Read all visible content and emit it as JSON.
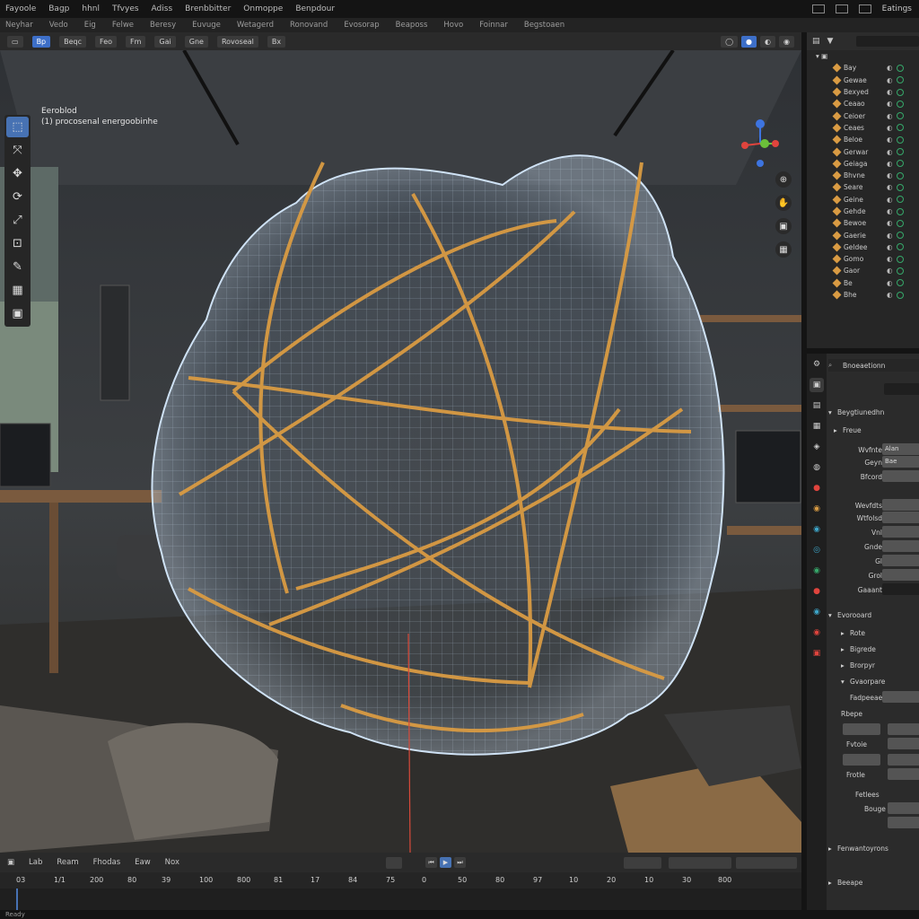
{
  "menubar": {
    "items": [
      "Fayoole",
      "Bagp",
      "hhnl",
      "Tfvyes",
      "Adiss",
      "Brenbbitter",
      "Onmoppe",
      "Benpdour"
    ],
    "right": [
      "Eatings"
    ]
  },
  "tabs": [
    "Neyhar",
    "Vedo",
    "Eig",
    "Felwe",
    "Beresy",
    "Euvuge",
    "Wetagerd",
    "Ronovand",
    "Evosorap",
    "Beaposs",
    "Hovo",
    "Foinnar",
    "Begstoaen"
  ],
  "viewport_header": {
    "mode": "Bp",
    "buttons": [
      "Beqc",
      "Feo",
      "Fm",
      "Gai",
      "Gne",
      "Rovoseal",
      "Bx"
    ]
  },
  "viewport": {
    "overlay_line1": "Eeroblod",
    "overlay_line2": "(1) procosenal energoobinhe"
  },
  "toolbar": {
    "tools": [
      {
        "name": "select-tool",
        "glyph": "⬚"
      },
      {
        "name": "cursor-tool",
        "glyph": "⤧"
      },
      {
        "name": "move-tool",
        "glyph": "✥"
      },
      {
        "name": "rotate-tool",
        "glyph": "⟳"
      },
      {
        "name": "scale-tool",
        "glyph": "⤢"
      },
      {
        "name": "transform-tool",
        "glyph": "⊡"
      },
      {
        "name": "annotate-tool",
        "glyph": "✎"
      },
      {
        "name": "measure-tool",
        "glyph": "▦"
      },
      {
        "name": "add-tool",
        "glyph": "▣"
      },
      {
        "name": "extra-tool",
        "glyph": "▤"
      }
    ]
  },
  "outliner": {
    "rows": [
      "Bay",
      "Gewae",
      "Bexyed",
      "Ceaao",
      "Ceioer",
      "Ceaes",
      "Beloe",
      "Gerwar",
      "Geiaga",
      "Bhvne",
      "Seare",
      "Geine",
      "Gehde",
      "Bewoe",
      "Gaerie",
      "Geldee",
      "Gomo",
      "Gaor",
      "Be",
      "Bhe"
    ]
  },
  "properties": {
    "title": "Bnoeaetionn",
    "section1": "Beygtiunedhn",
    "rows": [
      {
        "label": "Freue",
        "value": ""
      },
      {
        "label": "Wvfnte",
        "value": "Alan"
      },
      {
        "label": "Geyn",
        "value": "Bae"
      },
      {
        "label": "Bfcord",
        "value": ""
      },
      {
        "label": "Wevfdts",
        "value": ""
      },
      {
        "label": "Wtfolsd",
        "value": ""
      },
      {
        "label": "Vnl",
        "value": ""
      },
      {
        "label": "Gnde",
        "value": ""
      },
      {
        "label": "Gl",
        "value": ""
      },
      {
        "label": "Grol",
        "value": ""
      },
      {
        "label": "Gaaant",
        "value": ""
      }
    ],
    "section2": "Evorooard",
    "rows2": [
      "Rote",
      "Bigrede",
      "Brorpyr",
      "Gvaorpare"
    ],
    "section3": "Fadpeeaer",
    "rows3": [
      "Rbepe",
      "Fvtoie",
      "Frotle",
      "Fetlees",
      "Bouge"
    ],
    "section4": "Fenwantoyrons",
    "rows4": [
      "Beeape"
    ]
  },
  "timeline": {
    "labels": [
      "Lab",
      "Ream",
      "Fhodas",
      "Eaw",
      "Nox"
    ],
    "ticks": [
      "03",
      "1/1",
      "200",
      "80",
      "39",
      "100",
      "800",
      "81",
      "17",
      "84",
      "75",
      "0",
      "50",
      "80",
      "97",
      "10",
      "20",
      "10",
      "30",
      "800"
    ]
  },
  "status": {
    "text": "Ready"
  },
  "colors": {
    "accent": "#4772b3",
    "wire": "#d99b43",
    "mesh": "#b8d4f0"
  }
}
